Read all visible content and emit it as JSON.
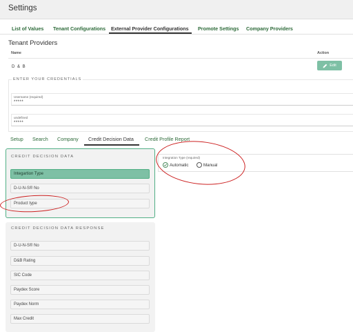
{
  "header": {
    "title": "Settings"
  },
  "main_tabs": [
    {
      "label": "List of Values",
      "active": false
    },
    {
      "label": "Tenant Configurations",
      "active": false
    },
    {
      "label": "External Provider Configurations",
      "active": true
    },
    {
      "label": "Promote Settings",
      "active": false
    },
    {
      "label": "Company Providers",
      "active": false
    }
  ],
  "tenant_providers": {
    "title": "Tenant Providers",
    "columns": {
      "name": "Name",
      "action": "Action"
    },
    "rows": [
      {
        "name": "D & B",
        "action_label": "Edit"
      }
    ]
  },
  "credentials": {
    "title": "ENTER YOUR CREDENTIALS",
    "username": {
      "label": "Username (required)",
      "value": "*****"
    },
    "second": {
      "label": "undefined",
      "value": "*****"
    }
  },
  "sub_tabs": [
    {
      "label": "Setup",
      "active": false
    },
    {
      "label": "Search",
      "active": false
    },
    {
      "label": "Company",
      "active": false
    },
    {
      "label": "Credit Decision Data",
      "active": true
    },
    {
      "label": "Credit Profile Report",
      "active": false
    }
  ],
  "credit_decision_data": {
    "title": "CREDIT DECISION DATA",
    "items": [
      {
        "label": "Integartion Type",
        "selected": true
      },
      {
        "label": "D-U-N-S® No",
        "selected": false
      },
      {
        "label": "Product type",
        "selected": false
      }
    ]
  },
  "credit_decision_response": {
    "title": "CREDIT DECISION DATA RESPONSE",
    "items": [
      "D-U-N-S® No",
      "D&B Rating",
      "SIC Code",
      "Paydex Score",
      "Paydex Norm",
      "Max Credit"
    ]
  },
  "integration_type": {
    "label": "Integration Type (required)",
    "options": [
      {
        "label": "Automatic",
        "checked": true,
        "icon": "check-circle-icon"
      },
      {
        "label": "Manual",
        "checked": false,
        "icon": "circle-icon"
      }
    ]
  },
  "colors": {
    "accent": "#7ec0a5",
    "accent_border": "#4fae84",
    "tab_text": "#2e6b3a",
    "annotation": "#cc1f1f"
  }
}
